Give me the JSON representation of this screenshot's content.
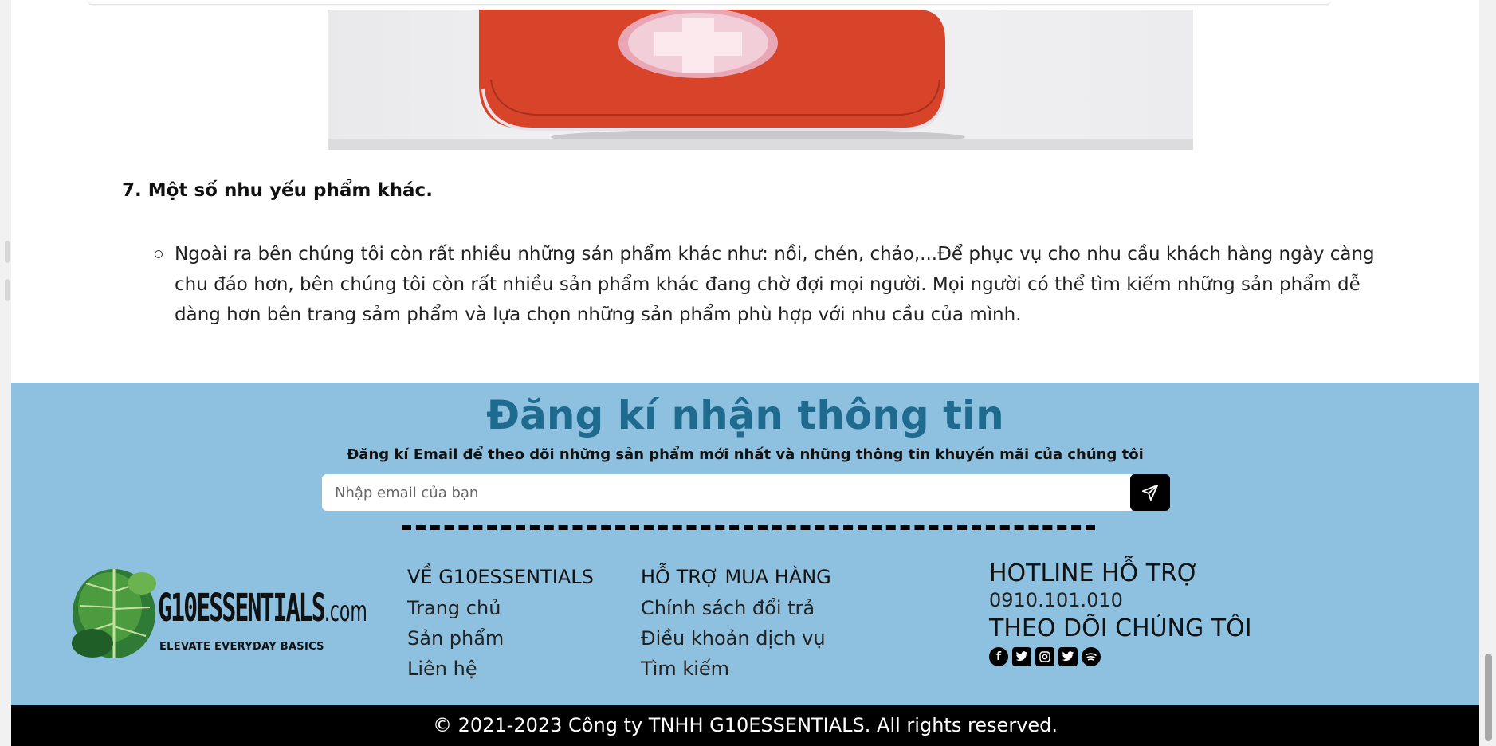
{
  "article": {
    "section_heading": "7. Một số nhu yếu phẩm khác.",
    "bullets": [
      "Ngoài ra bên chúng tôi còn rất nhiều những sản phẩm khác như: nồi, chén, chảo,...Để phục vụ cho nhu cầu khách hàng ngày càng chu đáo hơn, bên chúng tôi còn rất nhiều sản phẩm khác đang chờ đợi mọi người. Mọi người có thể tìm kiếm những sản phẩm dễ dàng hơn bên trang sảm phẩm và lựa chọn những sản phẩm phù hợp với nhu cầu của mình."
    ]
  },
  "newsletter": {
    "title": "Đăng kí nhận thông tin",
    "subtitle": "Đăng kí Email để theo dõi những sản phẩm mới nhất và những thông tin khuyến mãi của chúng tôi",
    "email_placeholder": "Nhập email của bạn",
    "submit_icon": "paper-plane-icon"
  },
  "logo": {
    "brand": "G10ESSENTIALS",
    "domain": ".com",
    "tagline": "ELEVATE EVERYDAY BASICS"
  },
  "footer": {
    "about": {
      "heading": "VỀ G10ESSENTIALS",
      "links": [
        "Trang chủ",
        "Sản phẩm",
        "Liên hệ"
      ]
    },
    "support": {
      "heading": "HỖ TRỢ MUA HÀNG",
      "links": [
        "Chính sách đổi trả",
        "Điều khoản dịch vụ",
        "Tìm kiếm"
      ]
    },
    "hotline": {
      "heading": "HOTLINE HỖ TRỢ",
      "phone": "0910.101.010",
      "follow_heading": "THEO DÕI CHÚNG TÔI",
      "socials": [
        "facebook-icon",
        "twitter-icon",
        "instagram-icon",
        "twitter-icon",
        "spotify-icon"
      ]
    }
  },
  "copyright": "© 2021-2023 Công ty TNHH G10ESSENTIALS. All rights reserved.",
  "colors": {
    "newsletter_bg": "#8ec1df",
    "newsletter_title": "#1f6a8f",
    "footer_bar": "#000000"
  }
}
